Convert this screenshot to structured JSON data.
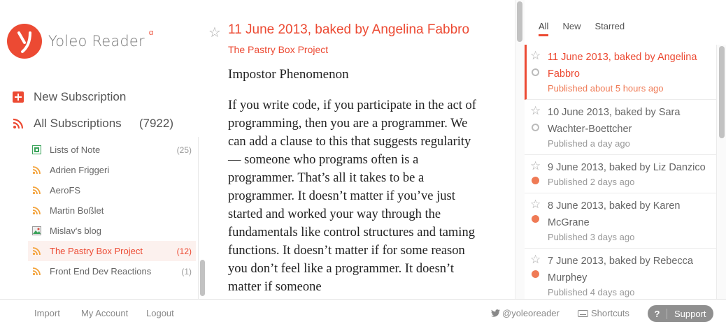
{
  "brand": {
    "name": "Yoleo Reader",
    "badge": "α",
    "accent": "#ec4a33"
  },
  "sidebar": {
    "new_subscription": "New Subscription",
    "all_subscriptions": {
      "label": "All Subscriptions",
      "count": "(7922)"
    },
    "feeds": [
      {
        "label": "Lists of Note",
        "count": "(25)",
        "icon": "grid-icon"
      },
      {
        "label": "Adrien Friggeri",
        "count": "",
        "icon": "rss-icon"
      },
      {
        "label": "AeroFS",
        "count": "",
        "icon": "rss-icon"
      },
      {
        "label": "Martin Boßlet",
        "count": "",
        "icon": "rss-icon"
      },
      {
        "label": "Mislav's blog",
        "count": "",
        "icon": "image-icon"
      },
      {
        "label": "The Pastry Box Project",
        "count": "(12)",
        "icon": "rss-icon",
        "active": true
      },
      {
        "label": "Front End Dev Reactions",
        "count": "(1)",
        "icon": "rss-icon"
      }
    ]
  },
  "article": {
    "title": "11 June 2013, baked by Angelina Fabbro",
    "source": "The Pastry Box Project",
    "heading": "Impostor Phenomenon",
    "body": "If you write code, if you participate in the act of programming, then you are a programmer. We can add a clause to this that suggests regularity — someone who programs often is a programmer. That’s all it takes to be a programmer. It doesn’t matter if you’ve just started and worked your way through the fundamentals like control structures and taming functions. It doesn’t matter if for some reason you don’t feel like a programmer. It doesn’t matter if someone"
  },
  "list": {
    "tabs": [
      "All",
      "New",
      "Starred"
    ],
    "active_tab": "All",
    "items": [
      {
        "title": "11 June 2013, baked by Angelina Fabbro",
        "published": "Published about 5 hours ago",
        "read": true,
        "selected": true
      },
      {
        "title": "10 June 2013, baked by Sara Wachter-Boettcher",
        "published": "Published a day ago",
        "read": true,
        "selected": false
      },
      {
        "title": "9 June 2013, baked by Liz Danzico",
        "published": "Published 2 days ago",
        "read": false,
        "selected": false
      },
      {
        "title": "8 June 2013, baked by Karen McGrane",
        "published": "Published 3 days ago",
        "read": false,
        "selected": false
      },
      {
        "title": "7 June 2013, baked by Rebecca Murphey",
        "published": "Published 4 days ago",
        "read": false,
        "selected": false
      }
    ]
  },
  "footer": {
    "import": "Import",
    "account": "My Account",
    "logout": "Logout",
    "twitter": "@yoleoreader",
    "shortcuts": "Shortcuts",
    "support_icon": "?",
    "support": "Support"
  }
}
